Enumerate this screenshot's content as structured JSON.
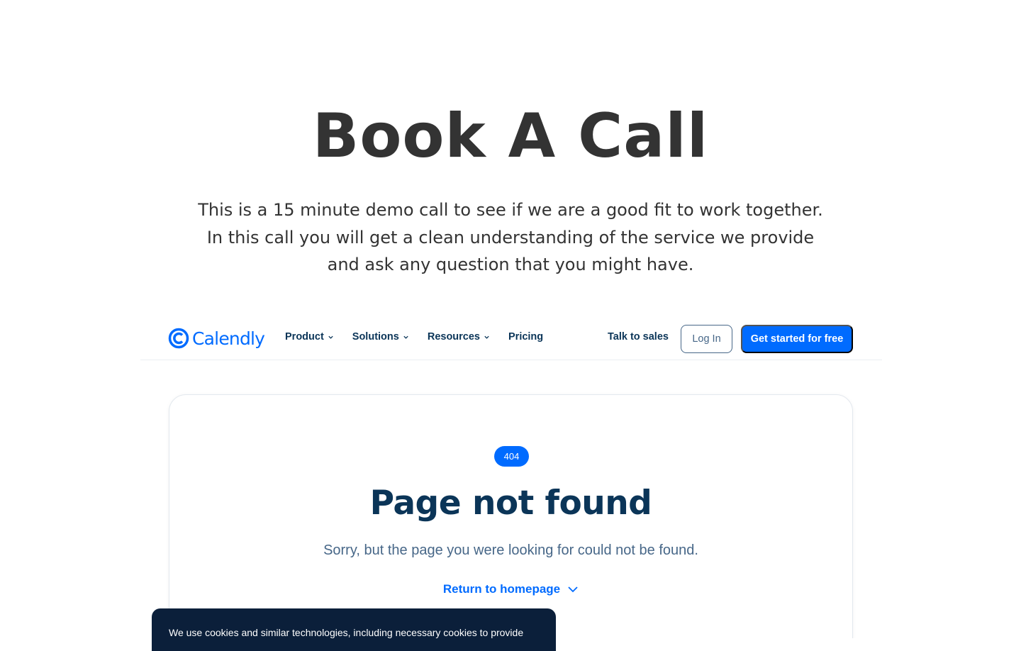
{
  "hero": {
    "title": "Book A Call",
    "description": "This is a 15 minute demo call to see if we are a good fit to work together. In this call you will get a clean understanding of the service we provide and ask any question that you might have."
  },
  "nav": {
    "logo_text": "Calendly",
    "items": [
      {
        "label": "Product",
        "icon": "chevron-down-icon"
      },
      {
        "label": "Solutions",
        "icon": "chevron-down-icon"
      },
      {
        "label": "Resources",
        "icon": "chevron-down-icon"
      },
      {
        "label": "Pricing"
      }
    ],
    "talk_to_sales": "Talk to sales",
    "login": "Log In",
    "get_started": "Get started for free"
  },
  "error": {
    "badge": "404",
    "title": "Page not found",
    "message": "Sorry, but the page you were looking for could not be found.",
    "return_link": "Return to homepage"
  },
  "cookie_banner": {
    "text": "We use cookies and similar technologies, including necessary cookies to provide"
  },
  "colors": {
    "brand_blue": "#006bff",
    "navy": "#0b3558",
    "text_dark": "#333333",
    "cookie_bg": "#0b1f3a"
  }
}
